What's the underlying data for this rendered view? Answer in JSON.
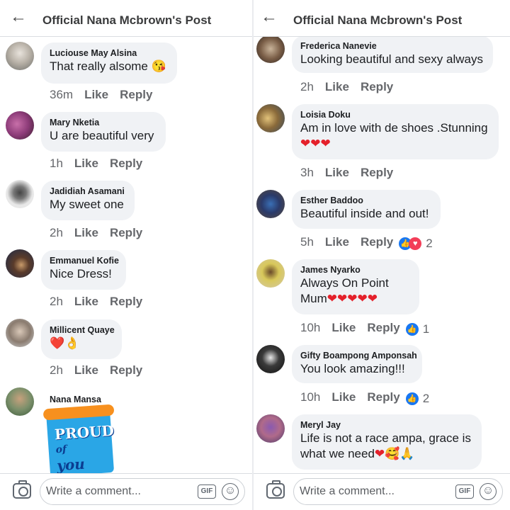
{
  "left": {
    "header": {
      "back_icon": "arrow-left",
      "title": "Official Nana Mcbrown's Post"
    },
    "comments": [
      {
        "author": "Luciouse May Alsina",
        "text": "That really alsome",
        "emoji": "😘",
        "time": "36m",
        "like": "Like",
        "reply": "Reply"
      },
      {
        "author": "Mary Nketia",
        "text": "U are beautiful very",
        "time": "1h",
        "like": "Like",
        "reply": "Reply"
      },
      {
        "author": "Jadidiah Asamani",
        "text": "My sweet one",
        "time": "2h",
        "like": "Like",
        "reply": "Reply"
      },
      {
        "author": "Emmanuel Kofie",
        "text": "Nice Dress!",
        "time": "2h",
        "like": "Like",
        "reply": "Reply"
      },
      {
        "author": "Millicent Quaye",
        "emoji": "❤️👌",
        "time": "2h",
        "like": "Like",
        "reply": "Reply"
      },
      {
        "author": "Nana Mansa"
      }
    ],
    "sticker": {
      "line1": "PROUD",
      "line2": "of",
      "line3": "you"
    },
    "composer": {
      "placeholder": "Write a comment...",
      "gif_label": "GIF"
    }
  },
  "right": {
    "header": {
      "back_icon": "arrow-left",
      "title": "Official Nana Mcbrown's Post"
    },
    "comments": [
      {
        "author": "Frederica Nanevie",
        "text": "Looking beautiful and sexy always",
        "time": "2h",
        "like": "Like",
        "reply": "Reply"
      },
      {
        "author": "Loisia Doku",
        "text": "Am in love with de shoes .Stunning",
        "emoji": "❤❤❤",
        "time": "3h",
        "like": "Like",
        "reply": "Reply"
      },
      {
        "author": "Esther Baddoo",
        "text": "Beautiful inside and out!",
        "time": "5h",
        "like": "Like",
        "reply": "Reply",
        "reaction_count": "2"
      },
      {
        "author": "James Nyarko",
        "text": "Always On Point",
        "text2": "Mum",
        "emoji": "❤❤❤❤❤",
        "time": "10h",
        "like": "Like",
        "reply": "Reply",
        "reaction_count": "1"
      },
      {
        "author": "Gifty Boampong Amponsah",
        "text": "You look amazing!!!",
        "time": "10h",
        "like": "Like",
        "reply": "Reply",
        "reaction_count": "2"
      },
      {
        "author": "Meryl Jay",
        "text": "Life is not a race ampa, grace is",
        "text2": "what we need",
        "emoji": "❤🥰🙏"
      }
    ],
    "composer": {
      "placeholder": "Write a comment...",
      "gif_label": "GIF"
    }
  },
  "colors": {
    "link_blue": "#1877f2",
    "bubble_gray": "#f0f2f5",
    "heart_red": "#e4212b"
  }
}
